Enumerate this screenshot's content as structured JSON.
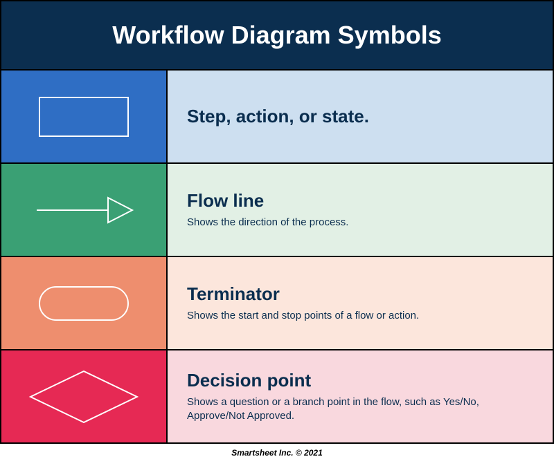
{
  "header": {
    "title": "Workflow Diagram Symbols"
  },
  "rows": {
    "step": {
      "title": "Step, action, or state.",
      "desc": ""
    },
    "flow": {
      "title": "Flow line",
      "desc": "Shows the direction of the process."
    },
    "term": {
      "title": "Terminator",
      "desc": "Shows the start and stop points of a flow or action."
    },
    "dec": {
      "title": "Decision point",
      "desc": "Shows a question or a branch point in the flow, such as Yes/No, Approve/Not Approved."
    }
  },
  "footer": "Smartsheet Inc. © 2021"
}
